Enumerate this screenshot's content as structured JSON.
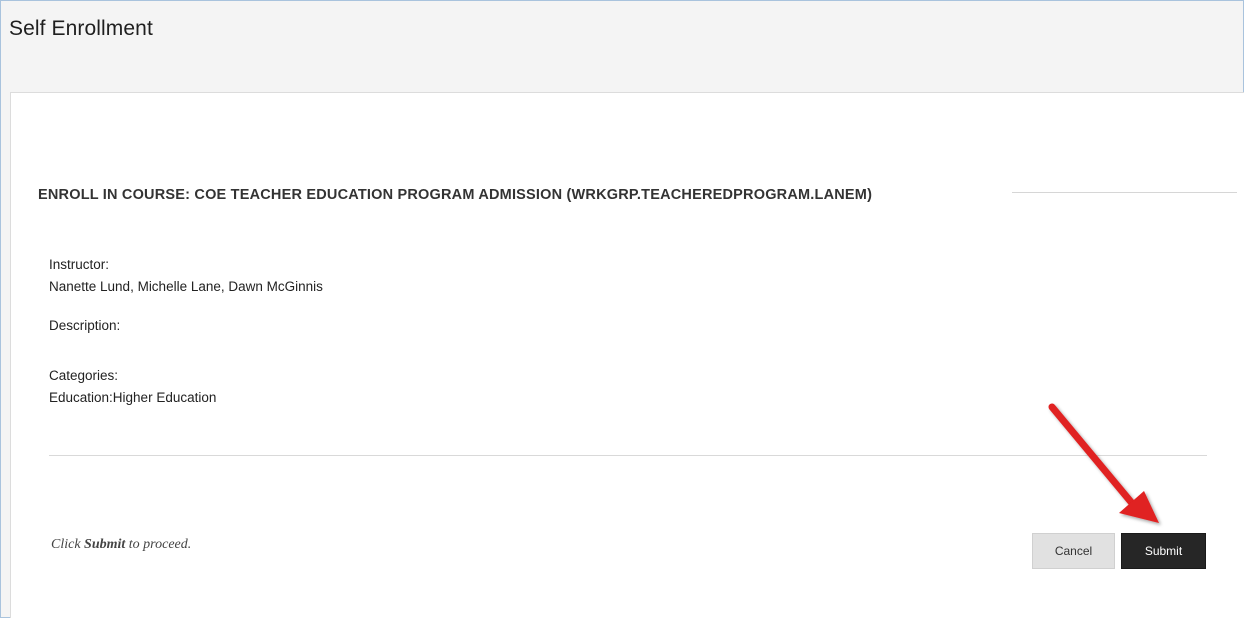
{
  "page": {
    "title": "Self Enrollment"
  },
  "enroll": {
    "heading": "ENROLL IN COURSE: COE TEACHER EDUCATION PROGRAM ADMISSION (WRKGRP.TEACHEREDPROGRAM.LANEM)",
    "fields": [
      {
        "label": "Instructor:",
        "value": "Nanette Lund, Michelle Lane, Dawn McGinnis"
      },
      {
        "label": "Description:",
        "value": ""
      },
      {
        "label": "Categories:",
        "value": "Education:Higher Education"
      }
    ]
  },
  "footer": {
    "instruction_prefix": "Click ",
    "instruction_emphasis": "Submit",
    "instruction_suffix": " to proceed.",
    "cancel_label": "Cancel",
    "submit_label": "Submit"
  },
  "annotation": {
    "icon": "red-arrow-icon",
    "color": "#e02020"
  },
  "colors": {
    "frame_border": "#a9c3dd",
    "header_background": "#f4f4f4",
    "submit_background": "#262626",
    "cancel_background": "#e1e1e1"
  }
}
